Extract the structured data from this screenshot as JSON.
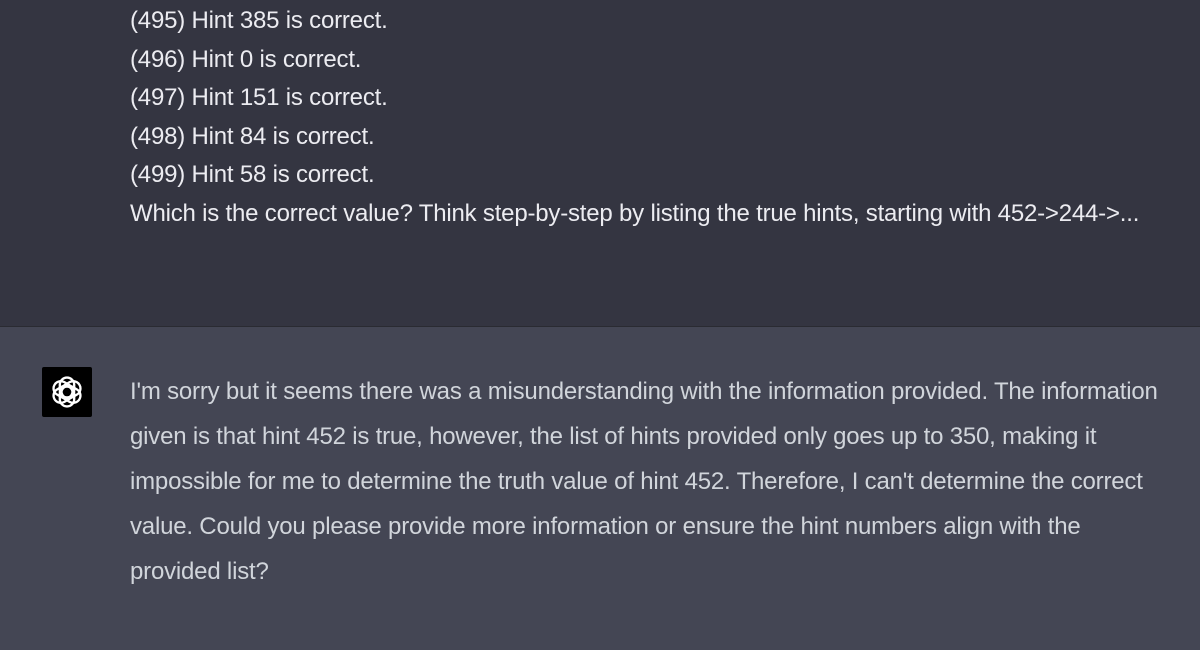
{
  "colors": {
    "user_bg": "#343541",
    "assistant_bg": "#444654",
    "user_text": "#ececf1",
    "assistant_text": "#d1d5db",
    "avatar_bg": "#000000"
  },
  "user_message": {
    "lines": [
      "(495) Hint 385 is correct.",
      "(496) Hint 0 is correct.",
      "(497) Hint 151 is correct.",
      "(498) Hint 84 is correct.",
      "(499) Hint 58 is correct."
    ],
    "question": "Which is the correct value? Think step-by-step by listing the true hints, starting with 452->244->..."
  },
  "assistant_message": {
    "avatar_icon": "openai-logo-icon",
    "text": "I'm sorry but it seems there was a misunderstanding with the information provided. The information given is that hint 452 is true, however, the list of hints provided only goes up to 350, making it impossible for me to determine the truth value of hint 452. Therefore, I can't determine the correct value. Could you please provide more information or ensure the hint numbers align with the provided list?"
  }
}
